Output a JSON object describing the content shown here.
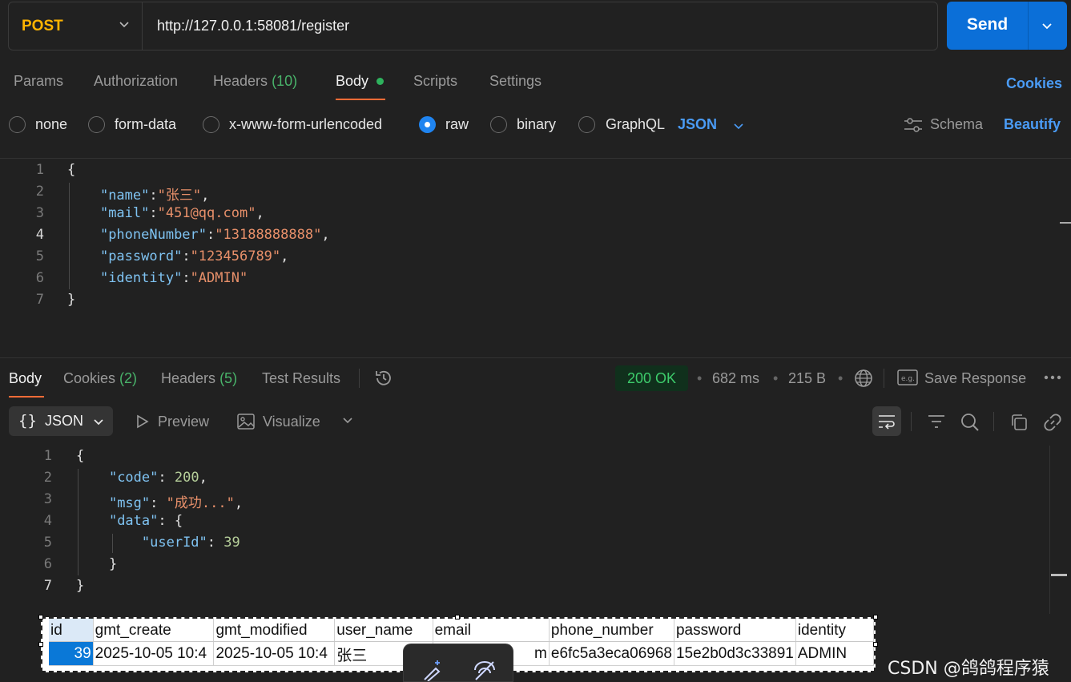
{
  "request": {
    "method": "POST",
    "url": "http://127.0.0.1:58081/register",
    "send_label": "Send",
    "tabs": [
      {
        "label": "Params"
      },
      {
        "label": "Authorization"
      },
      {
        "label": "Headers",
        "count": "(10)"
      },
      {
        "label": "Body"
      },
      {
        "label": "Scripts"
      },
      {
        "label": "Settings"
      }
    ],
    "cookies_label": "Cookies",
    "body_types": [
      "none",
      "form-data",
      "x-www-form-urlencoded",
      "raw",
      "binary",
      "GraphQL"
    ],
    "selected_body_type": "raw",
    "language": "JSON",
    "schema_label": "Schema",
    "beautify_label": "Beautify",
    "body_lines": {
      "open": "{",
      "close": "}",
      "fields": [
        {
          "key": "\"name\"",
          "value": "\"张三\"",
          "comma": ","
        },
        {
          "key": "\"mail\"",
          "value": "\"451@qq.com\"",
          "comma": ","
        },
        {
          "key": "\"phoneNumber\"",
          "value": "\"13188888888\"",
          "comma": ","
        },
        {
          "key": "\"password\"",
          "value": "\"123456789\"",
          "comma": ","
        },
        {
          "key": "\"identity\"",
          "value": "\"ADMIN\"",
          "comma": ""
        }
      ]
    },
    "line_numbers": [
      "1",
      "2",
      "3",
      "4",
      "5",
      "6",
      "7"
    ]
  },
  "response": {
    "tabs": [
      {
        "label": "Body"
      },
      {
        "label": "Cookies",
        "count": "(2)"
      },
      {
        "label": "Headers",
        "count": "(5)"
      },
      {
        "label": "Test Results"
      }
    ],
    "status": "200 OK",
    "time": "682 ms",
    "size": "215 B",
    "save_label": "Save Response",
    "format_label": "JSON",
    "preview_label": "Preview",
    "visualize_label": "Visualize",
    "line_numbers": [
      "1",
      "2",
      "3",
      "4",
      "5",
      "6",
      "7"
    ],
    "body": {
      "code_key": "\"code\"",
      "code_value": "200",
      "msg_key": "\"msg\"",
      "msg_value": "\"成功...\"",
      "data_key": "\"data\"",
      "userId_key": "\"userId\"",
      "userId_value": "39"
    }
  },
  "db_table": {
    "columns": [
      "id",
      "gmt_create",
      "gmt_modified",
      "user_name",
      "email",
      "phone_number",
      "password",
      "identity"
    ],
    "row": [
      "39",
      "2025-10-05 10:4",
      "2025-10-05 10:4",
      "张三",
      "m",
      "e6fc5a3eca06968",
      "15e2b0d3c33891",
      "ADMIN"
    ]
  },
  "watermark": "CSDN @鸽鸽程序猿",
  "colors": {
    "accent": "#ff6c37",
    "send": "#0b6fd8",
    "method": "#ffb400",
    "link": "#4a9bf5",
    "ok": "#3dcb6b"
  }
}
